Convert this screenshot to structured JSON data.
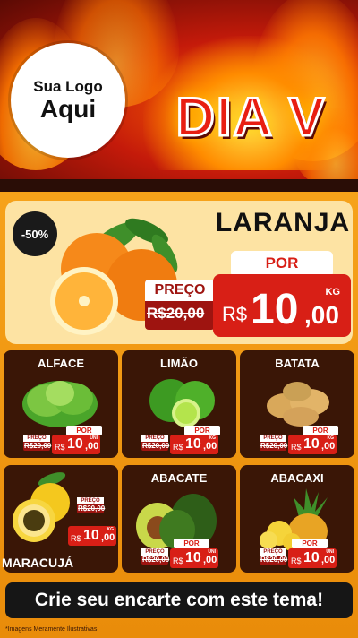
{
  "header": {
    "logo_line1": "Sua Logo",
    "logo_line2": "Aqui",
    "title": "DIA V"
  },
  "featured": {
    "discount_badge": "-50%",
    "name": "LARANJA",
    "por_label": "POR",
    "preco_label": "PREÇO",
    "old_price": "R$20,00",
    "currency": "R$",
    "price_int": "10",
    "price_dec": ",00",
    "unit": "KG"
  },
  "products": [
    {
      "name": "ALFACE",
      "por": "POR",
      "preco": "PREÇO",
      "old": "R$20,00",
      "currency": "R$",
      "int": "10",
      "dec": ",00",
      "unit": "UNI"
    },
    {
      "name": "LIMÃO",
      "por": "POR",
      "preco": "PREÇO",
      "old": "R$20,00",
      "currency": "R$",
      "int": "10",
      "dec": ",00",
      "unit": "KG"
    },
    {
      "name": "BATATA",
      "por": "POR",
      "preco": "PREÇO",
      "old": "R$20,00",
      "currency": "R$",
      "int": "10",
      "dec": ",00",
      "unit": "KG"
    },
    {
      "name": "MARACUJÁ",
      "por": "",
      "preco": "PREÇO",
      "old": "R$20,00",
      "currency": "R$",
      "int": "10",
      "dec": ",00",
      "unit": "KG"
    },
    {
      "name": "ABACATE",
      "por": "POR",
      "preco": "PREÇO",
      "old": "R$20,00",
      "currency": "R$",
      "int": "10",
      "dec": ",00",
      "unit": "UNI"
    },
    {
      "name": "ABACAXI",
      "por": "POR",
      "preco": "PREÇO",
      "old": "R$20,00",
      "currency": "R$",
      "int": "10",
      "dec": ",00",
      "unit": "UNI"
    }
  ],
  "cta": "Crie seu encarte com este tema!",
  "footnote": "*Imagens Meramente Ilustrativas",
  "colors": {
    "red": "#d81f16",
    "dark_red": "#9e1410",
    "card_bg": "#3a1606",
    "orange": "#f6a21a"
  }
}
